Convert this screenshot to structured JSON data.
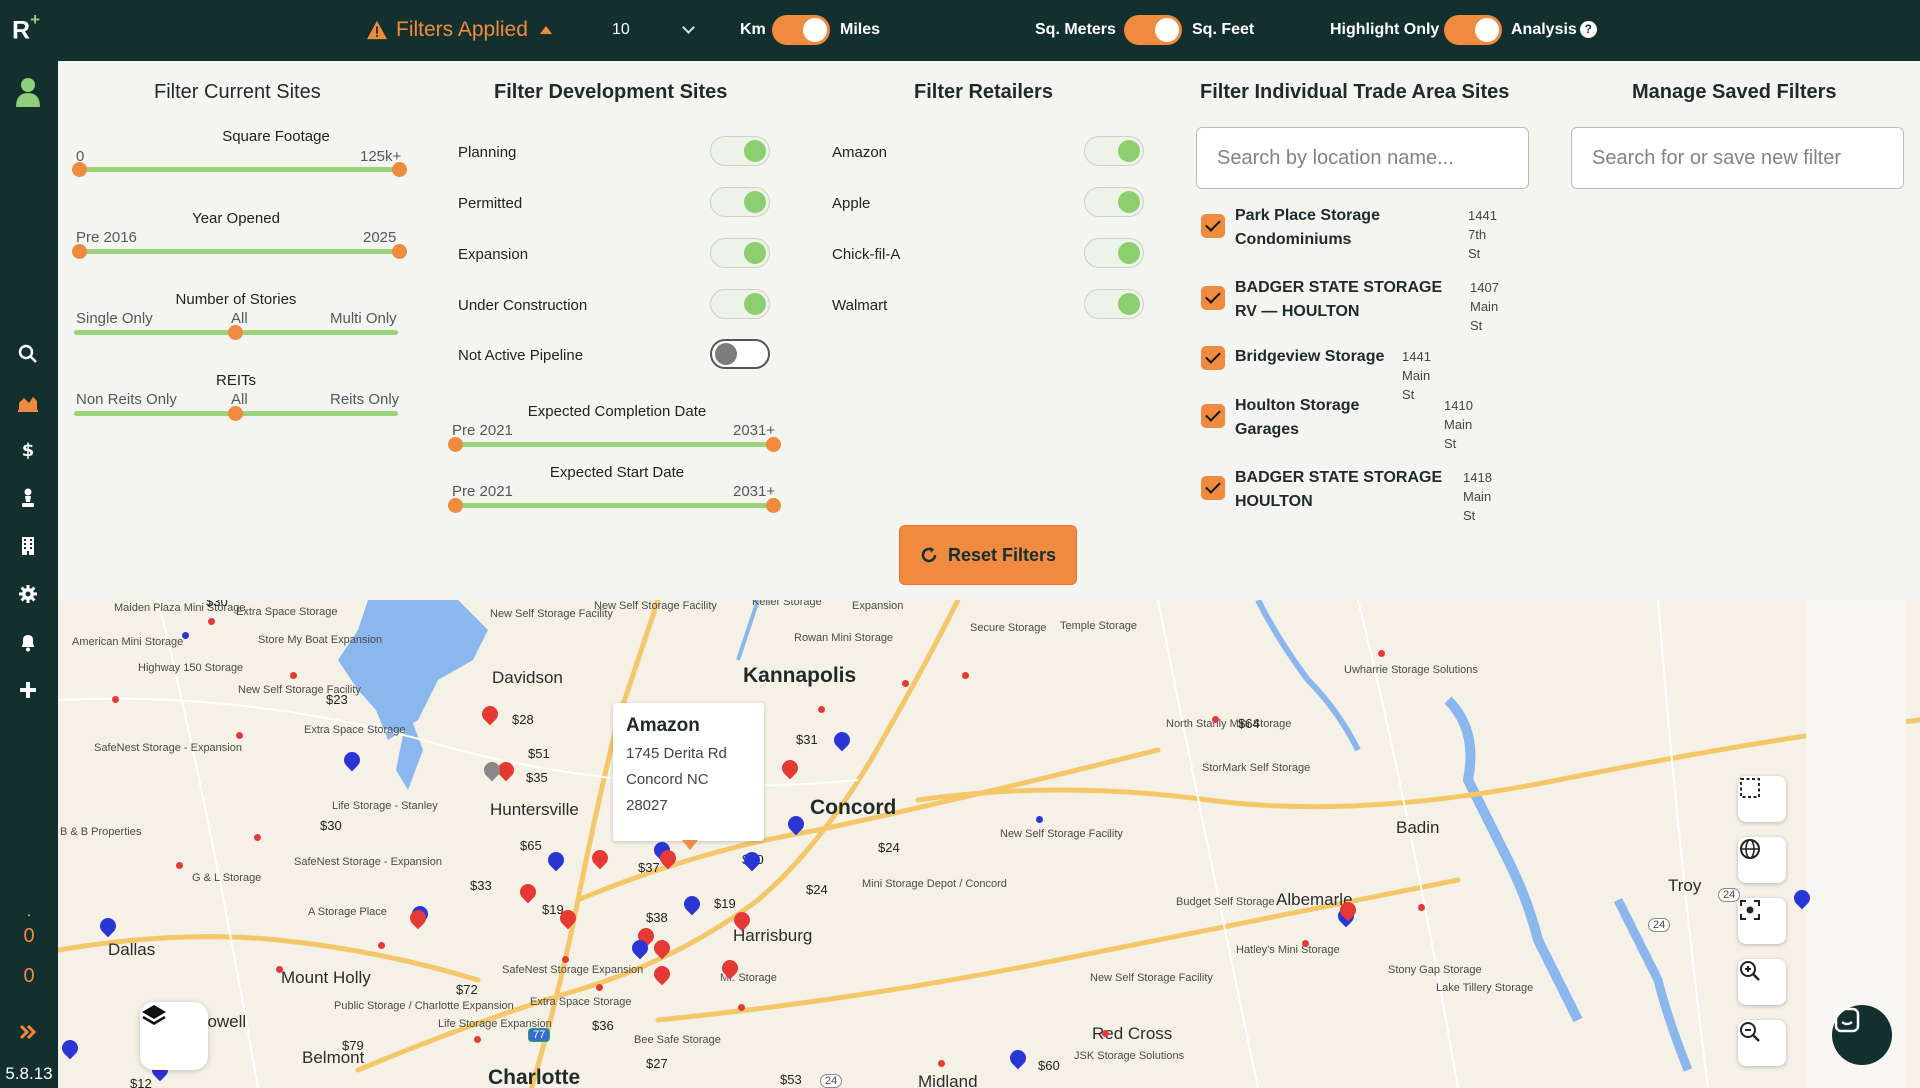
{
  "app": {
    "logo": "R",
    "logo_plus": "+",
    "version": "5.8.13"
  },
  "topbar": {
    "filters_applied": "Filters Applied",
    "radius_value": "10",
    "unit_left": "Km",
    "unit_right": "Miles",
    "area_left": "Sq. Meters",
    "area_right": "Sq. Feet",
    "mode_left": "Highlight Only",
    "mode_right": "Analysis",
    "help": "?"
  },
  "sidebar": {
    "count_a": "0",
    "count_b": "0"
  },
  "current_sites": {
    "title": "Filter Current Sites",
    "sliders": [
      {
        "title": "Square Footage",
        "min": "0",
        "mid": "",
        "max": "125k+"
      },
      {
        "title": "Year Opened",
        "min": "Pre 2016",
        "mid": "",
        "max": "2025"
      },
      {
        "title": "Number of Stories",
        "min": "Single Only",
        "mid": "All",
        "max": "Multi Only"
      },
      {
        "title": "REITs",
        "min": "Non Reits Only",
        "mid": "All",
        "max": "Reits Only"
      }
    ]
  },
  "development_sites": {
    "title": "Filter Development Sites",
    "toggles": [
      {
        "label": "Planning",
        "on": true
      },
      {
        "label": "Permitted",
        "on": true
      },
      {
        "label": "Expansion",
        "on": true
      },
      {
        "label": "Under Construction",
        "on": true
      },
      {
        "label": "Not Active Pipeline",
        "on": false
      }
    ],
    "sliders": [
      {
        "title": "Expected Completion Date",
        "min": "Pre 2021",
        "max": "2031+"
      },
      {
        "title": "Expected Start Date",
        "min": "Pre 2021",
        "max": "2031+"
      }
    ]
  },
  "retailers": {
    "title": "Filter Retailers",
    "toggles": [
      {
        "label": "Amazon",
        "on": true
      },
      {
        "label": "Apple",
        "on": true
      },
      {
        "label": "Chick-fil-A",
        "on": true
      },
      {
        "label": "Walmart",
        "on": true
      }
    ]
  },
  "trade_area": {
    "title": "Filter Individual Trade Area Sites",
    "search_placeholder": "Search by location name...",
    "sites": [
      {
        "name1": "Park Place Storage",
        "name2": "Condominiums",
        "addr1": "1441 7th",
        "addr2": "St"
      },
      {
        "name1": "BADGER STATE STORAGE",
        "name2": "RV — HOULTON",
        "addr1": "1407",
        "addr2": "Main St"
      },
      {
        "name1": "Bridgeview Storage",
        "name2": "",
        "addr1": "1441 Main St",
        "addr2": ""
      },
      {
        "name1": "Houlton Storage",
        "name2": "Garages",
        "addr1": "1410 Main",
        "addr2": "St"
      },
      {
        "name1": "BADGER STATE STORAGE",
        "name2": "HOULTON",
        "addr1": "1418",
        "addr2": "Main St"
      }
    ]
  },
  "saved_filters": {
    "title": "Manage Saved Filters",
    "search_placeholder": "Search for or save new filter"
  },
  "reset_label": "Reset Filters",
  "popup": {
    "title": "Amazon",
    "line1": "1745 Derita Rd",
    "line2": "Concord NC",
    "line3": "28027"
  },
  "map": {
    "cities": [
      "Kannapolis",
      "Concord",
      "Davidson",
      "Huntersville",
      "Harrisburg",
      "Mount Holly",
      "Dallas",
      "Lowell",
      "Belmont",
      "Charlotte",
      "Midland",
      "Albemarle",
      "Badin",
      "Troy",
      "Red Cross"
    ],
    "storage_labels": [
      "Maiden Plaza Mini Storage",
      "Extra Space Storage",
      "Store My Boat Expansion",
      "American Mini Storage",
      "Highway 150 Storage",
      "New Self Storage Facility",
      "Extra Space Storage",
      "SafeNest Storage - Expansion",
      "Life Storage - Stanley",
      "B & B Properties",
      "G & L Storage",
      "SafeNest Storage - Expansion",
      "A Storage Place",
      "Public Storage / Charlotte Expansion",
      "Life Storage Expansion",
      "SafeNest Storage Expansion",
      "Extra Space Storage",
      "Bee Safe Storage",
      "Mr. Storage",
      "Mini Storage Depot / Concord",
      "New Self Storage Facility",
      "Rowan Mini Storage",
      "Secure Storage",
      "Temple Storage",
      "North Stanly Mini Storage",
      "StorMark Self Storage",
      "Uwharrie Storage Solutions",
      "Budget Self Storage",
      "Hatley's Mini Storage",
      "Stony Gap Storage",
      "Lake Tillery Storage",
      "New Self Storage Facility",
      "JSK Storage Solutions",
      "New Self Storage Facility",
      "Keller Storage",
      "Expansion",
      "New Self Storage Facility"
    ],
    "prices": [
      "$30",
      "$23",
      "$28",
      "$51",
      "$35",
      "$30",
      "$65",
      "$33",
      "$19",
      "$37",
      "$38",
      "$30",
      "$19",
      "$24",
      "$24",
      "$31",
      "$72",
      "$36",
      "$79",
      "$27",
      "$53",
      "$60",
      "$64",
      "$12"
    ],
    "road_shields": [
      "24",
      "24",
      "24",
      "77"
    ]
  }
}
